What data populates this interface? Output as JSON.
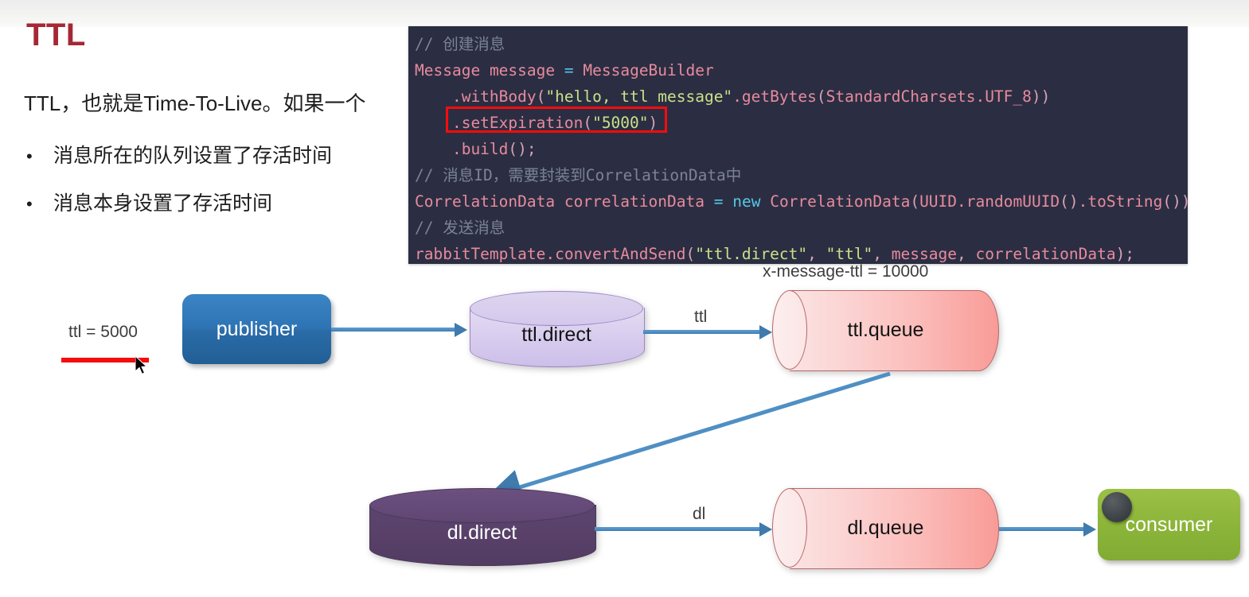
{
  "slide": {
    "title": "TTL",
    "intro": "TTL，也就是Time-To-Live。如果一个",
    "bullet_marker": "•",
    "bullets": [
      "消息所在的队列设置了存活时间",
      "消息本身设置了存活时间"
    ],
    "title_color": "#a52834"
  },
  "code": {
    "background": "#2b2e42",
    "highlight_border_color": "#f60c0c",
    "lines": [
      {
        "tokens": [
          {
            "t": "// 创建消息",
            "c": "cm"
          }
        ]
      },
      {
        "tokens": [
          {
            "t": "Message",
            "c": "id"
          },
          {
            "t": " ",
            "c": "pn"
          },
          {
            "t": "message",
            "c": "id"
          },
          {
            "t": " ",
            "c": "pn"
          },
          {
            "t": "=",
            "c": "op"
          },
          {
            "t": " ",
            "c": "pn"
          },
          {
            "t": "MessageBuilder",
            "c": "id"
          }
        ]
      },
      {
        "tokens": [
          {
            "t": "    .withBody",
            "c": "id"
          },
          {
            "t": "(",
            "c": "pn"
          },
          {
            "t": "\"hello, ttl message\"",
            "c": "st"
          },
          {
            "t": ".getBytes",
            "c": "id"
          },
          {
            "t": "(",
            "c": "pn"
          },
          {
            "t": "StandardCharsets.UTF_8",
            "c": "id"
          },
          {
            "t": "))",
            "c": "pn"
          }
        ]
      },
      {
        "tokens": [
          {
            "t": "    .setExpiration",
            "c": "id"
          },
          {
            "t": "(",
            "c": "pn"
          },
          {
            "t": "\"5000\"",
            "c": "st"
          },
          {
            "t": ")",
            "c": "pn"
          }
        ]
      },
      {
        "tokens": [
          {
            "t": "    .build",
            "c": "id"
          },
          {
            "t": "();",
            "c": "pn"
          }
        ]
      },
      {
        "tokens": [
          {
            "t": "// 消息ID，需要封装到CorrelationData中",
            "c": "cm"
          }
        ]
      },
      {
        "tokens": [
          {
            "t": "CorrelationData",
            "c": "id"
          },
          {
            "t": " ",
            "c": "pn"
          },
          {
            "t": "correlationData",
            "c": "id"
          },
          {
            "t": " ",
            "c": "pn"
          },
          {
            "t": "=",
            "c": "op"
          },
          {
            "t": " ",
            "c": "pn"
          },
          {
            "t": "new",
            "c": "kw"
          },
          {
            "t": " ",
            "c": "pn"
          },
          {
            "t": "CorrelationData",
            "c": "id"
          },
          {
            "t": "(",
            "c": "pn"
          },
          {
            "t": "UUID.randomUUID",
            "c": "id"
          },
          {
            "t": "()",
            "c": "pn"
          },
          {
            "t": ".toString",
            "c": "id"
          },
          {
            "t": "());",
            "c": "pn"
          }
        ]
      },
      {
        "tokens": [
          {
            "t": "// 发送消息",
            "c": "cm"
          }
        ]
      },
      {
        "tokens": [
          {
            "t": "rabbitTemplate.convertAndSend",
            "c": "id"
          },
          {
            "t": "(",
            "c": "pn"
          },
          {
            "t": "\"ttl.direct\"",
            "c": "st"
          },
          {
            "t": ", ",
            "c": "pn"
          },
          {
            "t": "\"ttl\"",
            "c": "st"
          },
          {
            "t": ", ",
            "c": "pn"
          },
          {
            "t": "message",
            "c": "id"
          },
          {
            "t": ", ",
            "c": "pn"
          },
          {
            "t": "correlationData",
            "c": "id"
          },
          {
            "t": ");",
            "c": "pn"
          }
        ]
      }
    ]
  },
  "diagram": {
    "annotations": {
      "ttl_value": "ttl = 5000",
      "x_message_ttl": "x-message-ttl = 10000"
    },
    "nodes": {
      "publisher": "publisher",
      "ttl_direct": "ttl.direct",
      "ttl_queue": "ttl.queue",
      "dl_direct": "dl.direct",
      "dl_queue": "dl.queue",
      "consumer": "consumer"
    },
    "edge_labels": {
      "ttl": "ttl",
      "dl": "dl"
    },
    "colors": {
      "publisher": "#2e74b5",
      "consumer": "#8cb53a",
      "ttl_direct": "#d6cbee",
      "dl_direct": "#584068",
      "queue": "#fbbcb9",
      "arrow": "#4f8fc4",
      "red_underline": "#f50c0c"
    }
  }
}
